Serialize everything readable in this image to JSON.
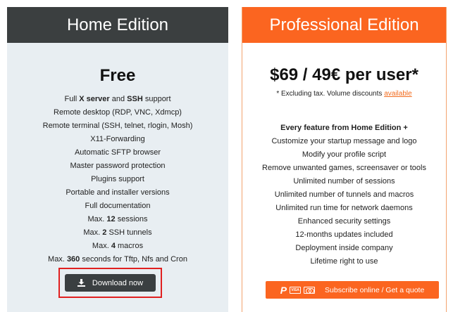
{
  "home": {
    "title": "Home Edition",
    "price": "Free",
    "features": [
      [
        {
          "t": "Full "
        },
        {
          "t": "X server",
          "b": true
        },
        {
          "t": " and "
        },
        {
          "t": "SSH",
          "b": true
        },
        {
          "t": " support"
        }
      ],
      [
        {
          "t": "Remote desktop (RDP, VNC, Xdmcp)"
        }
      ],
      [
        {
          "t": "Remote terminal (SSH, telnet, rlogin, Mosh)"
        }
      ],
      [
        {
          "t": "X11-Forwarding"
        }
      ],
      [
        {
          "t": "Automatic SFTP browser"
        }
      ],
      [
        {
          "t": "Master password protection"
        }
      ],
      [
        {
          "t": "Plugins support"
        }
      ],
      [
        {
          "t": "Portable and installer versions"
        }
      ],
      [
        {
          "t": "Full documentation"
        }
      ],
      [
        {
          "t": "Max. "
        },
        {
          "t": "12",
          "b": true
        },
        {
          "t": " sessions"
        }
      ],
      [
        {
          "t": "Max. "
        },
        {
          "t": "2",
          "b": true
        },
        {
          "t": " SSH tunnels"
        }
      ],
      [
        {
          "t": "Max. "
        },
        {
          "t": "4",
          "b": true
        },
        {
          "t": " macros"
        }
      ],
      [
        {
          "t": "Max. "
        },
        {
          "t": "360",
          "b": true
        },
        {
          "t": " seconds for Tftp, Nfs and Cron"
        }
      ]
    ],
    "download_label": "Download now",
    "download_icon": "download-icon"
  },
  "pro": {
    "title": "Professional Edition",
    "price": "$69 / 49€ per user*",
    "tax_note": "* Excluding tax. Volume discounts ",
    "tax_link": "available",
    "headline": "Every feature from Home Edition +",
    "features": [
      "Customize your startup message and logo",
      "Modify your profile script",
      "Remove unwanted games, screensaver or tools",
      "Unlimited number of sessions",
      "Unlimited number of tunnels and macros",
      "Unlimited run time for network daemons",
      "Enhanced security settings",
      "12-months updates included",
      "Deployment inside company",
      "Lifetime right to use"
    ],
    "subscribe_label": "Subscribe online / Get a quote",
    "payment_icons": [
      "paypal-icon",
      "visa-icon",
      "mastercard-icon"
    ],
    "paypal_glyph": "P",
    "visa_text": "VISA"
  },
  "colors": {
    "home_header": "#3b3f40",
    "pro_header": "#fb6520",
    "home_bg": "#e8eef2",
    "highlight": "#e02020"
  }
}
